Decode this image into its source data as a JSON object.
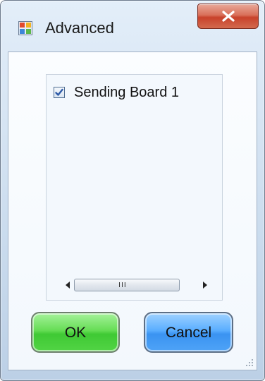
{
  "window": {
    "title": "Advanced",
    "icon": "app-window-icon",
    "close_icon": "close-x-icon"
  },
  "list": {
    "items": [
      {
        "label": "Sending Board 1",
        "checked": true
      }
    ],
    "scrollbar": {
      "grip_label": "III"
    }
  },
  "buttons": {
    "ok_label": "OK",
    "cancel_label": "Cancel"
  },
  "colors": {
    "ok_green": "#4fd044",
    "cancel_blue": "#4aa0f5",
    "close_red": "#c8422b",
    "checkmark_blue": "#2d5aa7"
  }
}
